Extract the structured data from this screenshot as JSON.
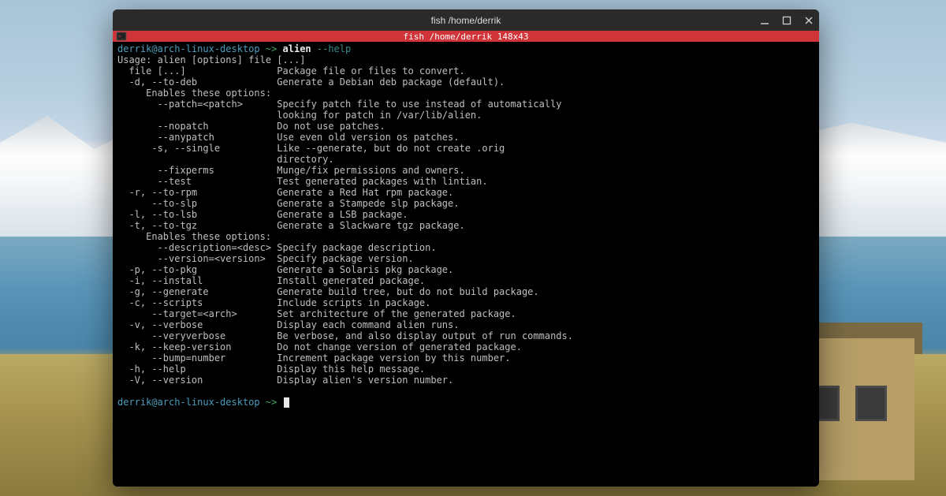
{
  "window": {
    "title": "fish  /home/derrik",
    "controls": {
      "min": "minimize",
      "max": "maximize",
      "close": "close"
    }
  },
  "tab": {
    "title": "fish  /home/derrik 148x43"
  },
  "prompt": {
    "user_host": "derrik@arch-linux-desktop",
    "arrow": " ~> ",
    "cmd": "alien",
    "cmd_arg": " --help"
  },
  "help": {
    "usage": "Usage: alien [options] file [...]",
    "lines": [
      [
        "  file [...]",
        "Package file or files to convert."
      ],
      [
        "  -d, --to-deb",
        "Generate a Debian deb package (default)."
      ],
      [
        "     Enables these options:",
        ""
      ],
      [
        "       --patch=<patch>",
        "Specify patch file to use instead of automatically"
      ],
      [
        "",
        "looking for patch in /var/lib/alien."
      ],
      [
        "       --nopatch",
        "Do not use patches."
      ],
      [
        "       --anypatch",
        "Use even old version os patches."
      ],
      [
        "      -s, --single",
        "Like --generate, but do not create .orig"
      ],
      [
        "",
        "directory."
      ],
      [
        "       --fixperms",
        "Munge/fix permissions and owners."
      ],
      [
        "       --test",
        "Test generated packages with lintian."
      ],
      [
        "  -r, --to-rpm",
        "Generate a Red Hat rpm package."
      ],
      [
        "      --to-slp",
        "Generate a Stampede slp package."
      ],
      [
        "  -l, --to-lsb",
        "Generate a LSB package."
      ],
      [
        "  -t, --to-tgz",
        "Generate a Slackware tgz package."
      ],
      [
        "     Enables these options:",
        ""
      ],
      [
        "       --description=<desc>",
        "Specify package description."
      ],
      [
        "       --version=<version>",
        "Specify package version."
      ],
      [
        "  -p, --to-pkg",
        "Generate a Solaris pkg package."
      ],
      [
        "  -i, --install",
        "Install generated package."
      ],
      [
        "  -g, --generate",
        "Generate build tree, but do not build package."
      ],
      [
        "  -c, --scripts",
        "Include scripts in package."
      ],
      [
        "      --target=<arch>",
        "Set architecture of the generated package."
      ],
      [
        "  -v, --verbose",
        "Display each command alien runs."
      ],
      [
        "      --veryverbose",
        "Be verbose, and also display output of run commands."
      ],
      [
        "  -k, --keep-version",
        "Do not change version of generated package."
      ],
      [
        "      --bump=number",
        "Increment package version by this number."
      ],
      [
        "  -h, --help",
        "Display this help message."
      ],
      [
        "  -V, --version",
        "Display alien's version number."
      ]
    ],
    "desc_col": 28
  },
  "prompt2": {
    "user_host": "derrik@arch-linux-desktop",
    "arrow": " ~> "
  }
}
